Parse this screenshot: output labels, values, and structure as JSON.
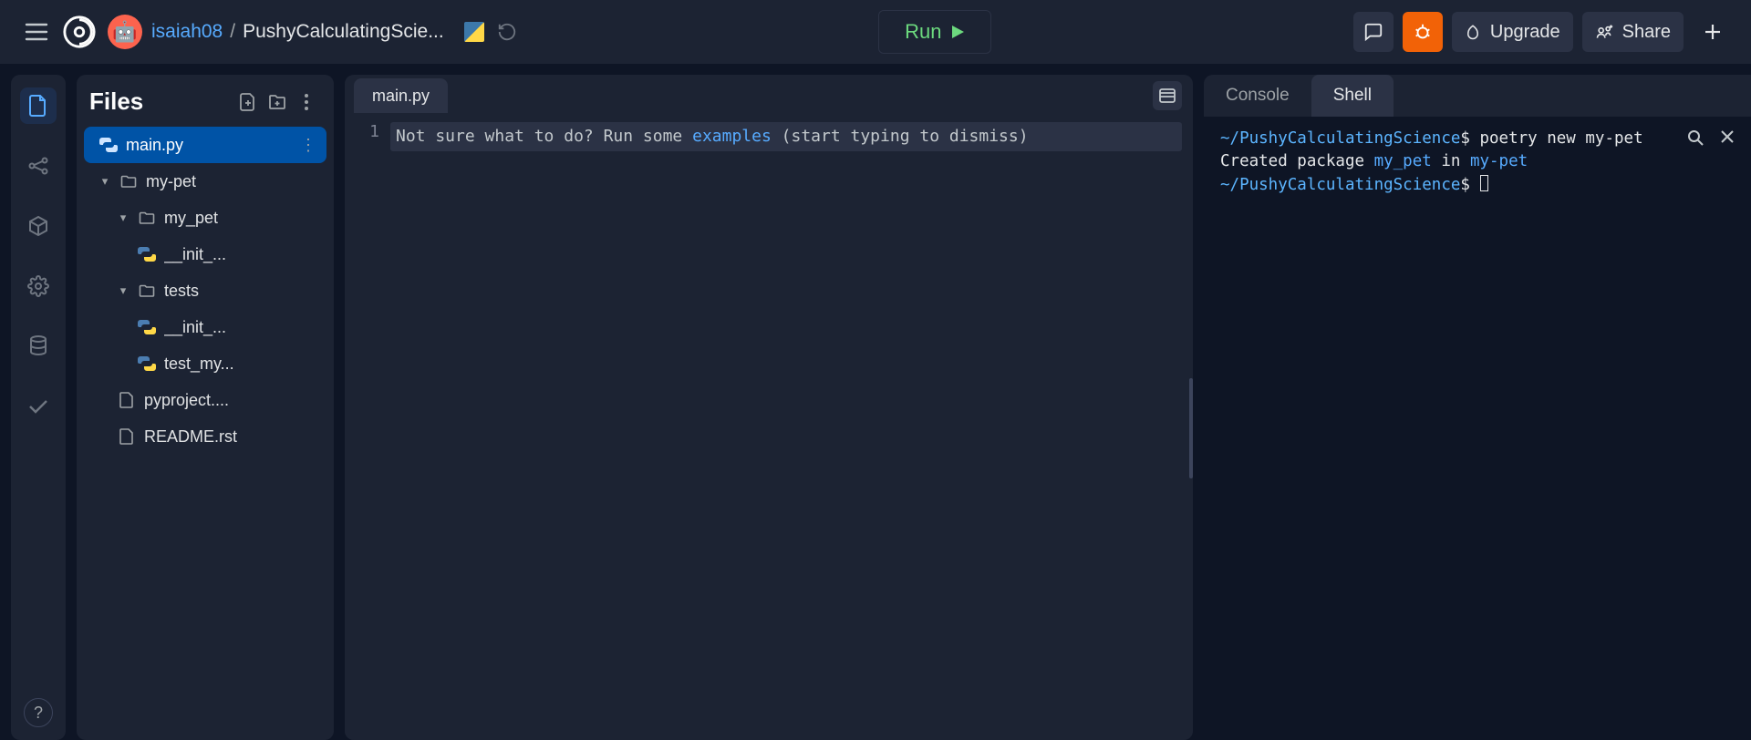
{
  "header": {
    "username": "isaiah08",
    "replname": "PushyCalculatingScie...",
    "run_label": "Run",
    "upgrade_label": "Upgrade",
    "share_label": "Share"
  },
  "sidebar": {
    "title": "Files",
    "selected_file": "main.py",
    "tree": {
      "folder1": "my-pet",
      "folder2": "my_pet",
      "file2a": "__init_...",
      "folder3": "tests",
      "file3a": "__init_...",
      "file3b": "test_my...",
      "file4": "pyproject....",
      "file5": "README.rst"
    }
  },
  "editor": {
    "tab": "main.py",
    "line_number": "1",
    "hint_pre": "Not sure what to do? Run some ",
    "hint_link": "examples",
    "hint_post": " (start typing to dismiss)"
  },
  "right": {
    "tab_console": "Console",
    "tab_shell": "Shell"
  },
  "terminal": {
    "path": "~/PushyCalculatingScience",
    "prompt": "$",
    "cmd1": " poetry new my-pet",
    "line2_pre": "Created package ",
    "line2_pkg": "my_pet",
    "line2_mid": " in ",
    "line2_dir": "my-pet"
  },
  "help_label": "?"
}
